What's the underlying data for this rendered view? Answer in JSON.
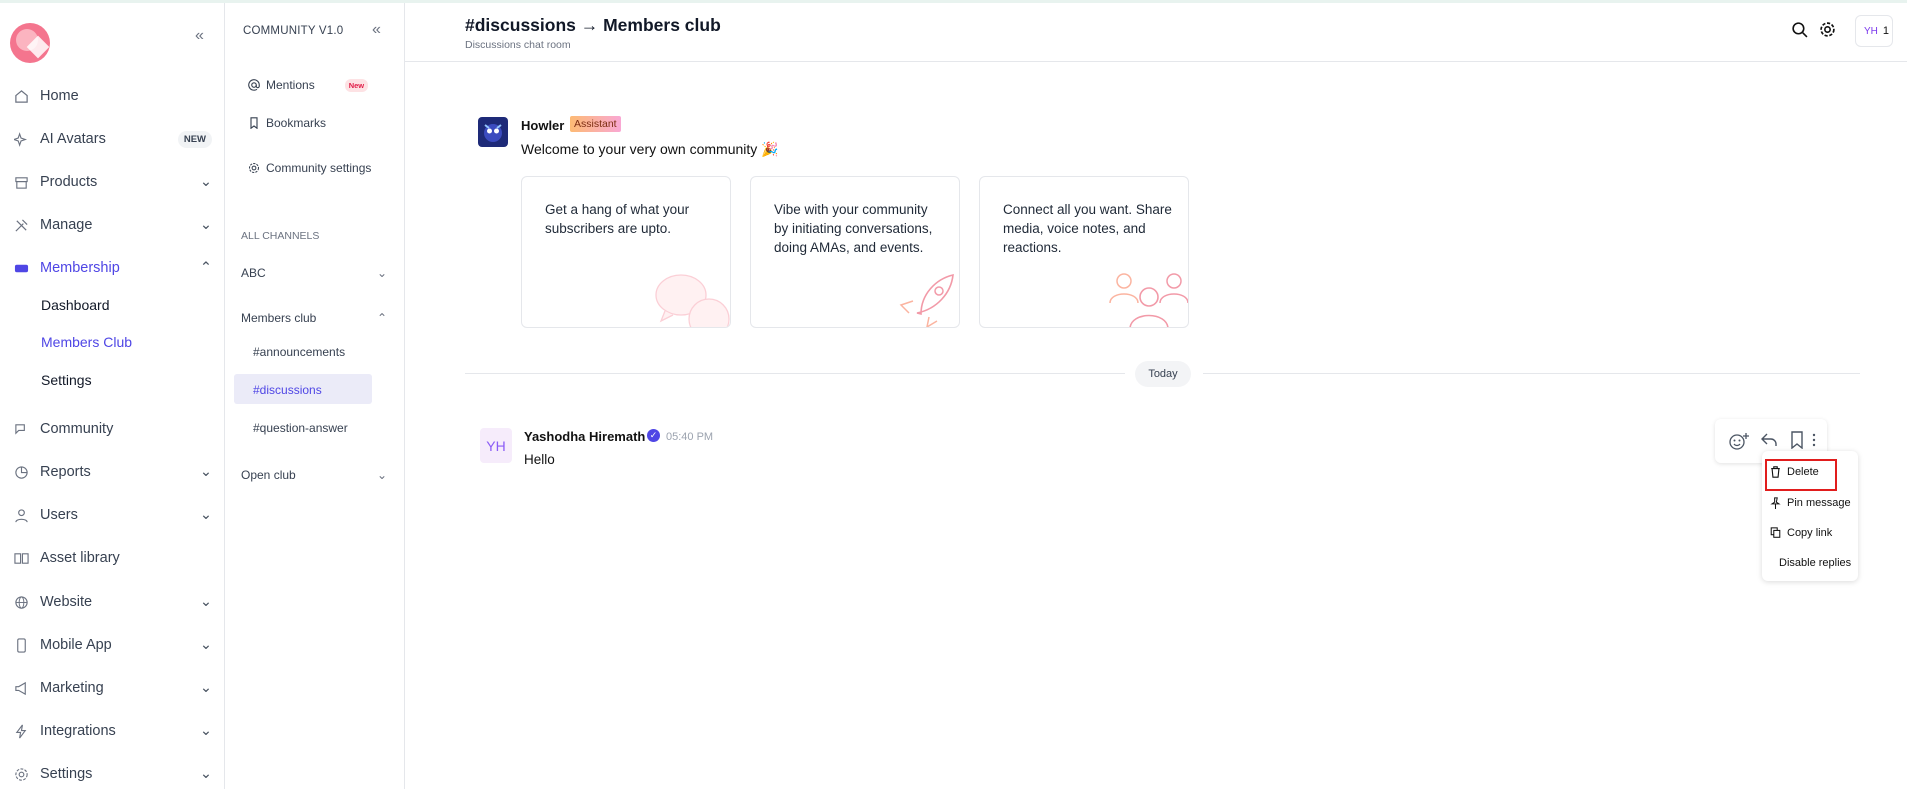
{
  "sidebar": {
    "items": [
      {
        "label": "Home",
        "icon": "home-icon"
      },
      {
        "label": "AI Avatars",
        "icon": "sparkle-icon",
        "badge": "NEW"
      },
      {
        "label": "Products",
        "icon": "box-icon"
      },
      {
        "label": "Manage",
        "icon": "tools-icon"
      },
      {
        "label": "Membership",
        "icon": "membership-icon"
      },
      {
        "label": "Community",
        "icon": "chat-icon"
      },
      {
        "label": "Reports",
        "icon": "pie-chart-icon"
      },
      {
        "label": "Users",
        "icon": "user-icon"
      },
      {
        "label": "Asset library",
        "icon": "book-icon"
      },
      {
        "label": "Website",
        "icon": "globe-icon"
      },
      {
        "label": "Mobile App",
        "icon": "mobile-icon"
      },
      {
        "label": "Marketing",
        "icon": "megaphone-icon"
      },
      {
        "label": "Integrations",
        "icon": "bolt-icon"
      },
      {
        "label": "Settings",
        "icon": "gear-icon"
      }
    ],
    "membership_sub": [
      "Dashboard",
      "Members Club",
      "Settings"
    ]
  },
  "panel": {
    "title": "COMMUNITY V1.0",
    "mentions": "Mentions",
    "mentions_badge": "New",
    "bookmarks": "Bookmarks",
    "community_settings": "Community settings",
    "section": "ALL CHANNELS",
    "groups": [
      "ABC",
      "Members club",
      "Open club"
    ],
    "channels": [
      "#announcements",
      "#discussions",
      "#question-answer"
    ]
  },
  "header": {
    "title": "#discussions → Members club",
    "subtitle": "Discussions chat room",
    "avatar": "YH",
    "count": "1"
  },
  "bot": {
    "name": "Howler",
    "tag": "Assistant",
    "welcome": "Welcome to your very own community 🎉",
    "cards": [
      "Get a hang of what your subscribers are upto.",
      "Vibe with your community by initiating conversations, doing AMAs, and events.",
      "Connect all you want. Share media, voice notes, and reactions."
    ]
  },
  "chat": {
    "day": "Today",
    "message": {
      "initials": "YH",
      "author": "Yashodha Hiremath",
      "time": "05:40 PM",
      "text": "Hello"
    }
  },
  "menu": {
    "items": [
      "Delete",
      "Pin message",
      "Copy link",
      "Disable replies"
    ]
  },
  "colors": {
    "accent": "#4f46e5",
    "brand": "#f4758e",
    "highlight": "#e11d1d"
  }
}
